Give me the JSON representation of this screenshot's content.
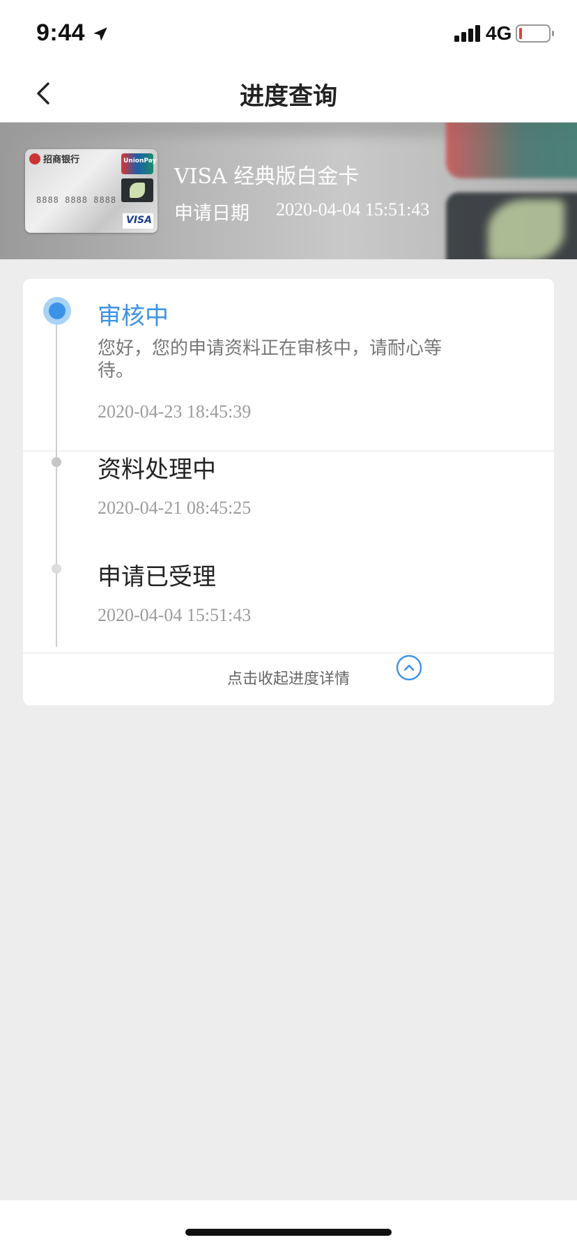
{
  "status_bar": {
    "time": "9:44",
    "network": "4G",
    "icons": [
      "location-arrow-icon",
      "signal-icon",
      "battery-icon"
    ]
  },
  "nav": {
    "title": "进度查询",
    "back_icon": "chevron-left-icon"
  },
  "card": {
    "name": "VISA 经典版白金卡",
    "apply_date_label": "申请日期",
    "apply_date": "2020-04-04 15:51:43",
    "thumb_bank": "招商银行",
    "thumb_number": "8888 8888 8888",
    "thumb_unionpay": "UnionPay",
    "thumb_visa": "VISA"
  },
  "progress": {
    "steps": [
      {
        "title": "审核中",
        "desc": "您好，您的申请资料正在审核中，请耐心等待。",
        "time": "2020-04-23 18:45:39",
        "active": true
      },
      {
        "title": "资料处理中",
        "time": "2020-04-21 08:45:25",
        "active": false
      },
      {
        "title": "申请已受理",
        "time": "2020-04-04 15:51:43",
        "active": false
      }
    ],
    "collapse_label": "点击收起进度详情",
    "collapse_icon": "chevron-up-circle-icon"
  },
  "colors": {
    "accent": "#3b93e8",
    "background": "#ededed",
    "text": "#222222",
    "muted": "#9c9c9c"
  }
}
